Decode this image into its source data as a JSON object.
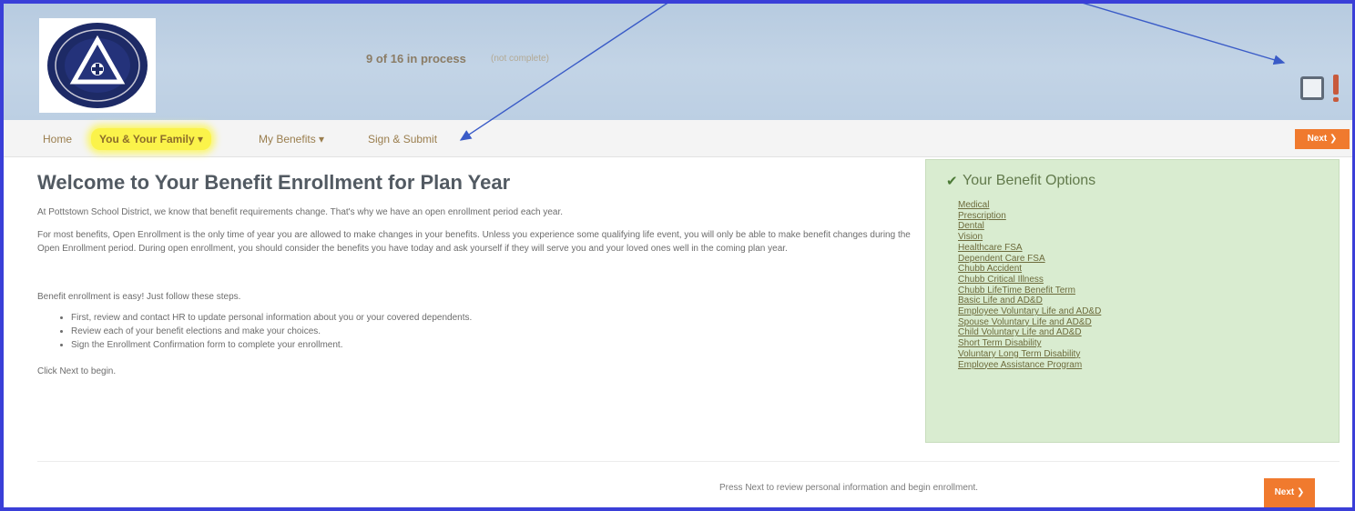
{
  "header": {
    "progress": "9 of 16 in process",
    "progress_sub": "(not complete)"
  },
  "nav": {
    "home": "Home",
    "family": "You & Your Family ▾",
    "benefits": "My Benefits ▾",
    "sign": "Sign & Submit",
    "next_top": "Next ❯"
  },
  "main": {
    "title": "Welcome to Your Benefit Enrollment for Plan Year",
    "p1": "At Pottstown School District, we know that benefit requirements change. That's why we have an open enrollment period each year.",
    "p2": "For most benefits, Open Enrollment is the only time of year you are allowed to make changes in your benefits. Unless you experience some qualifying life event, you will only be able to make benefit changes during the Open Enrollment period. During open enrollment, you should consider the benefits you have today and ask yourself if they will serve you and your loved ones well in the coming plan year.",
    "p3": "Benefit enrollment is easy! Just follow these steps.",
    "steps": [
      "First, review and contact HR to update personal information about you or your covered dependents.",
      "Review each of your benefit elections and make your choices.",
      "Sign the Enrollment Confirmation form to complete your enrollment."
    ],
    "p4": "Click Next to begin."
  },
  "options": {
    "title": "Your Benefit Options",
    "items": [
      "Medical",
      "Prescription",
      "Dental",
      "Vision",
      "Healthcare FSA",
      "Dependent Care FSA",
      "Chubb Accident",
      "Chubb Critical Illness",
      "Chubb LifeTime Benefit Term",
      "Basic Life and AD&D",
      "Employee Voluntary Life and AD&D",
      "Spouse Voluntary Life and AD&D",
      "Child Voluntary Life and AD&D",
      "Short Term Disability",
      "Voluntary Long Term Disability",
      "Employee Assistance Program"
    ]
  },
  "footer": {
    "text": "Press Next to review personal information and begin enrollment.",
    "next": "Next ❯"
  },
  "colors": {
    "frame": "#3a3fd8",
    "header_bg": "#c3d4e6",
    "accent_orange": "#f07a2e",
    "highlight": "#fbf34a",
    "options_bg": "#d9ecd0",
    "annotation_arrow": "#3a5bc7"
  },
  "icons": {
    "header_icon": "notification-alert-icon",
    "options_check": "checkmark-icon"
  }
}
